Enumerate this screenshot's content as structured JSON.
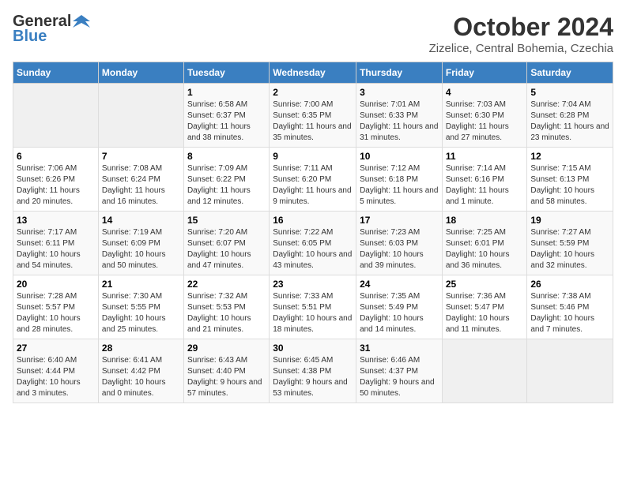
{
  "header": {
    "logo_general": "General",
    "logo_blue": "Blue",
    "month": "October 2024",
    "location": "Zizelice, Central Bohemia, Czechia"
  },
  "weekdays": [
    "Sunday",
    "Monday",
    "Tuesday",
    "Wednesday",
    "Thursday",
    "Friday",
    "Saturday"
  ],
  "weeks": [
    [
      {
        "day": "",
        "info": ""
      },
      {
        "day": "",
        "info": ""
      },
      {
        "day": "1",
        "info": "Sunrise: 6:58 AM\nSunset: 6:37 PM\nDaylight: 11 hours and 38 minutes."
      },
      {
        "day": "2",
        "info": "Sunrise: 7:00 AM\nSunset: 6:35 PM\nDaylight: 11 hours and 35 minutes."
      },
      {
        "day": "3",
        "info": "Sunrise: 7:01 AM\nSunset: 6:33 PM\nDaylight: 11 hours and 31 minutes."
      },
      {
        "day": "4",
        "info": "Sunrise: 7:03 AM\nSunset: 6:30 PM\nDaylight: 11 hours and 27 minutes."
      },
      {
        "day": "5",
        "info": "Sunrise: 7:04 AM\nSunset: 6:28 PM\nDaylight: 11 hours and 23 minutes."
      }
    ],
    [
      {
        "day": "6",
        "info": "Sunrise: 7:06 AM\nSunset: 6:26 PM\nDaylight: 11 hours and 20 minutes."
      },
      {
        "day": "7",
        "info": "Sunrise: 7:08 AM\nSunset: 6:24 PM\nDaylight: 11 hours and 16 minutes."
      },
      {
        "day": "8",
        "info": "Sunrise: 7:09 AM\nSunset: 6:22 PM\nDaylight: 11 hours and 12 minutes."
      },
      {
        "day": "9",
        "info": "Sunrise: 7:11 AM\nSunset: 6:20 PM\nDaylight: 11 hours and 9 minutes."
      },
      {
        "day": "10",
        "info": "Sunrise: 7:12 AM\nSunset: 6:18 PM\nDaylight: 11 hours and 5 minutes."
      },
      {
        "day": "11",
        "info": "Sunrise: 7:14 AM\nSunset: 6:16 PM\nDaylight: 11 hours and 1 minute."
      },
      {
        "day": "12",
        "info": "Sunrise: 7:15 AM\nSunset: 6:13 PM\nDaylight: 10 hours and 58 minutes."
      }
    ],
    [
      {
        "day": "13",
        "info": "Sunrise: 7:17 AM\nSunset: 6:11 PM\nDaylight: 10 hours and 54 minutes."
      },
      {
        "day": "14",
        "info": "Sunrise: 7:19 AM\nSunset: 6:09 PM\nDaylight: 10 hours and 50 minutes."
      },
      {
        "day": "15",
        "info": "Sunrise: 7:20 AM\nSunset: 6:07 PM\nDaylight: 10 hours and 47 minutes."
      },
      {
        "day": "16",
        "info": "Sunrise: 7:22 AM\nSunset: 6:05 PM\nDaylight: 10 hours and 43 minutes."
      },
      {
        "day": "17",
        "info": "Sunrise: 7:23 AM\nSunset: 6:03 PM\nDaylight: 10 hours and 39 minutes."
      },
      {
        "day": "18",
        "info": "Sunrise: 7:25 AM\nSunset: 6:01 PM\nDaylight: 10 hours and 36 minutes."
      },
      {
        "day": "19",
        "info": "Sunrise: 7:27 AM\nSunset: 5:59 PM\nDaylight: 10 hours and 32 minutes."
      }
    ],
    [
      {
        "day": "20",
        "info": "Sunrise: 7:28 AM\nSunset: 5:57 PM\nDaylight: 10 hours and 28 minutes."
      },
      {
        "day": "21",
        "info": "Sunrise: 7:30 AM\nSunset: 5:55 PM\nDaylight: 10 hours and 25 minutes."
      },
      {
        "day": "22",
        "info": "Sunrise: 7:32 AM\nSunset: 5:53 PM\nDaylight: 10 hours and 21 minutes."
      },
      {
        "day": "23",
        "info": "Sunrise: 7:33 AM\nSunset: 5:51 PM\nDaylight: 10 hours and 18 minutes."
      },
      {
        "day": "24",
        "info": "Sunrise: 7:35 AM\nSunset: 5:49 PM\nDaylight: 10 hours and 14 minutes."
      },
      {
        "day": "25",
        "info": "Sunrise: 7:36 AM\nSunset: 5:47 PM\nDaylight: 10 hours and 11 minutes."
      },
      {
        "day": "26",
        "info": "Sunrise: 7:38 AM\nSunset: 5:46 PM\nDaylight: 10 hours and 7 minutes."
      }
    ],
    [
      {
        "day": "27",
        "info": "Sunrise: 6:40 AM\nSunset: 4:44 PM\nDaylight: 10 hours and 3 minutes."
      },
      {
        "day": "28",
        "info": "Sunrise: 6:41 AM\nSunset: 4:42 PM\nDaylight: 10 hours and 0 minutes."
      },
      {
        "day": "29",
        "info": "Sunrise: 6:43 AM\nSunset: 4:40 PM\nDaylight: 9 hours and 57 minutes."
      },
      {
        "day": "30",
        "info": "Sunrise: 6:45 AM\nSunset: 4:38 PM\nDaylight: 9 hours and 53 minutes."
      },
      {
        "day": "31",
        "info": "Sunrise: 6:46 AM\nSunset: 4:37 PM\nDaylight: 9 hours and 50 minutes."
      },
      {
        "day": "",
        "info": ""
      },
      {
        "day": "",
        "info": ""
      }
    ]
  ]
}
